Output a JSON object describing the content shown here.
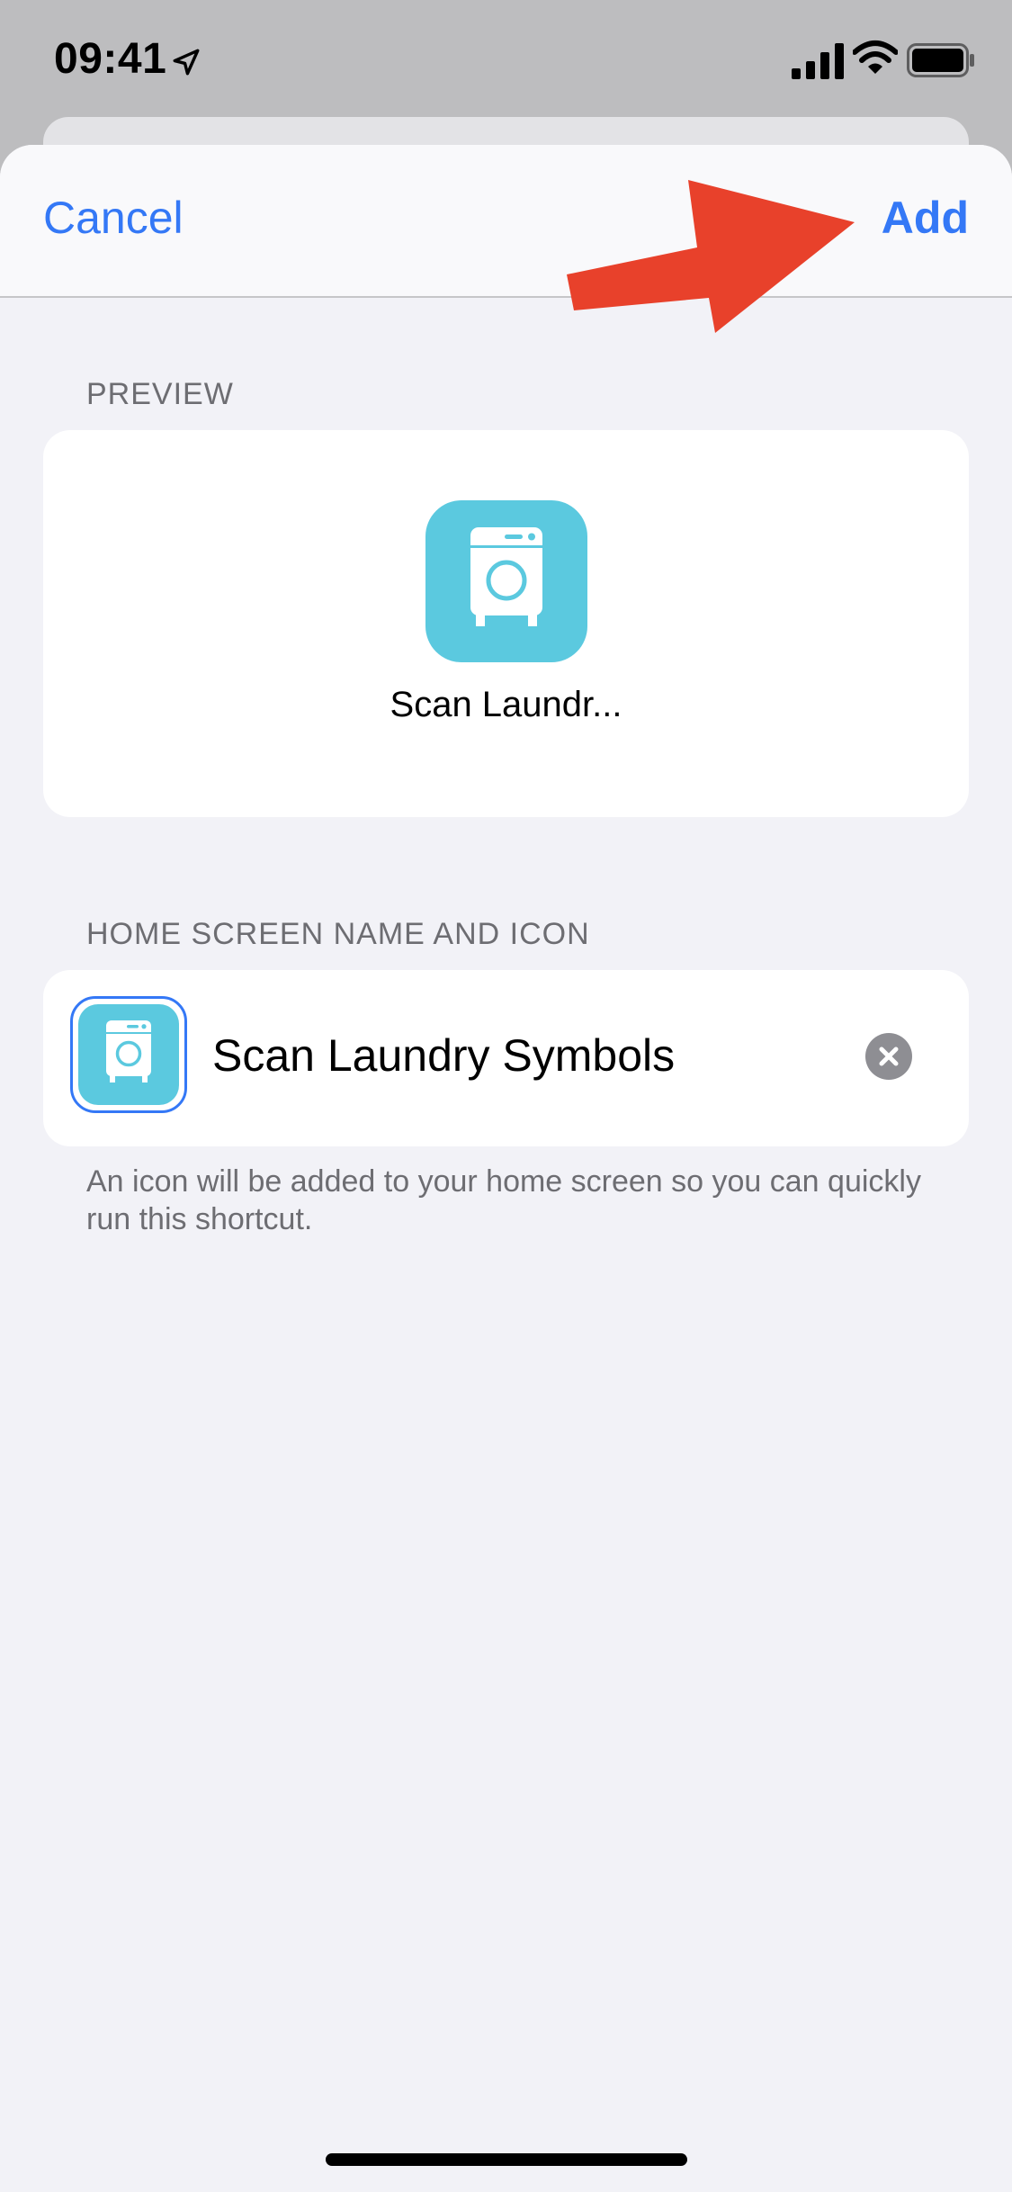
{
  "status_bar": {
    "time": "09:41",
    "icons": [
      "location-arrow-icon",
      "cellular-signal-icon",
      "wifi-icon",
      "battery-icon"
    ]
  },
  "nav": {
    "cancel_label": "Cancel",
    "add_label": "Add"
  },
  "preview": {
    "header": "PREVIEW",
    "shortcut_label": "Scan Laundr...",
    "icon": "washing-machine-icon"
  },
  "home_screen": {
    "header": "HOME SCREEN NAME AND ICON",
    "name_value": "Scan Laundry Symbols",
    "icon": "washing-machine-icon",
    "clear_icon": "clear-text-icon",
    "footer": "An icon will be added to your home screen so you can quickly run this shortcut."
  },
  "colors": {
    "accent": "#3478F6",
    "icon_background": "#5BC9DF",
    "annotation_arrow": "#E8412B",
    "sheet_background": "#F2F2F7",
    "secondary_text": "#6D6D72"
  }
}
